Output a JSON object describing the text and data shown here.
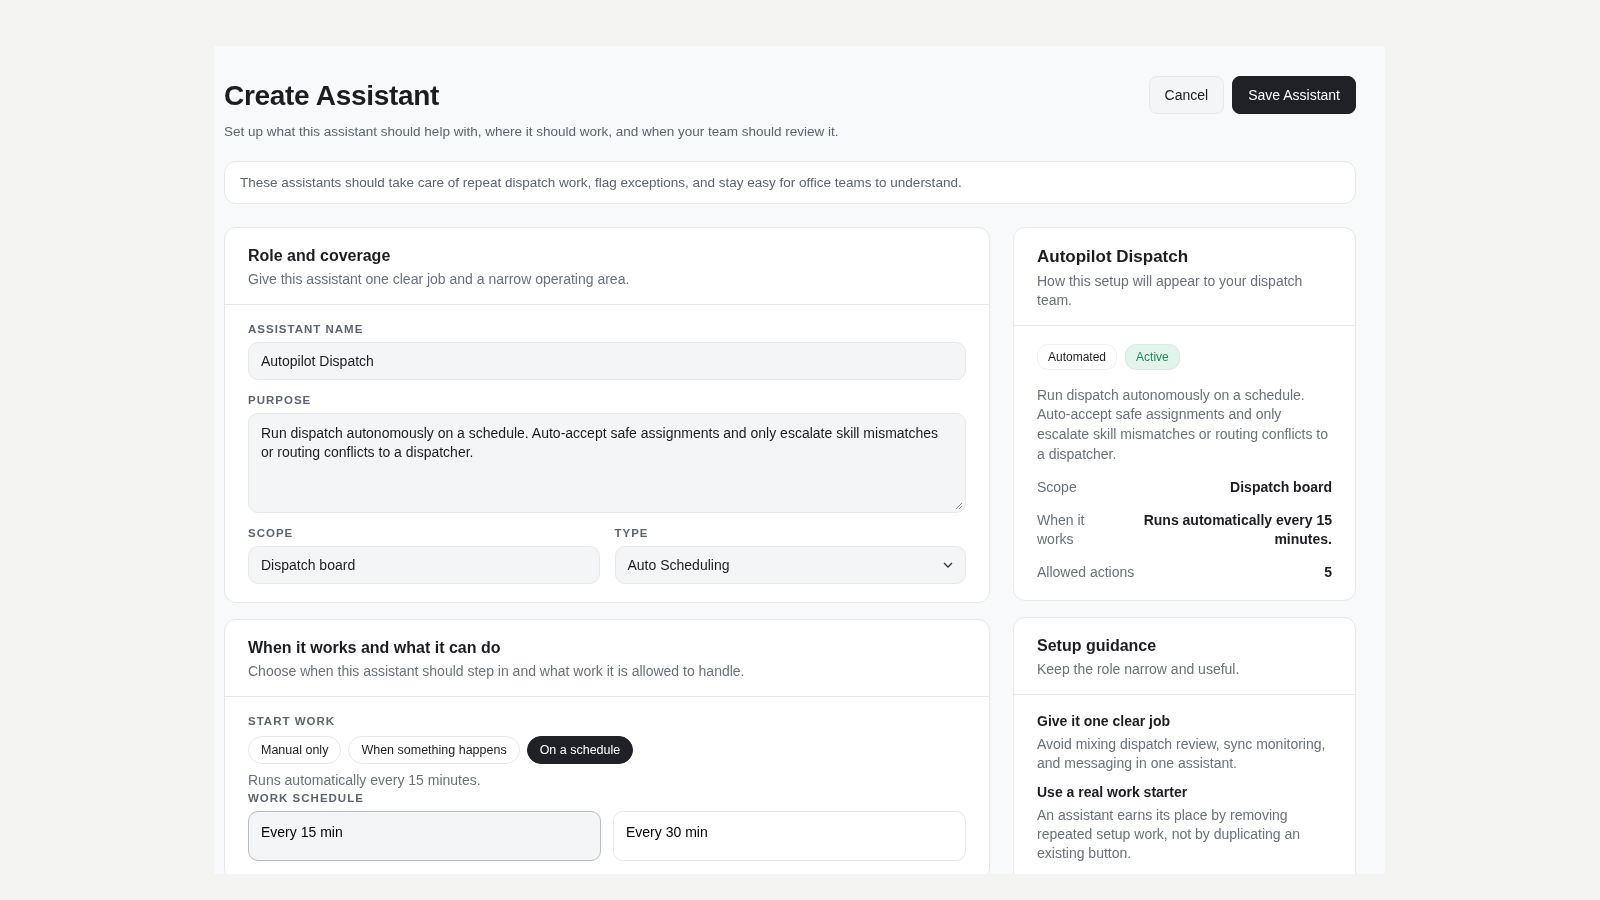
{
  "page": {
    "title": "Create Assistant",
    "subtitle": "Set up what this assistant should help with, where it should work, and when your team should review it."
  },
  "actions": [
    {
      "label": "Cancel",
      "kind": "secondary"
    },
    {
      "label": "Save Assistant",
      "kind": "primary"
    }
  ],
  "notice": "These assistants should take care of repeat dispatch work, flag exceptions, and stay easy for office teams to understand.",
  "role_section": {
    "title": "Role and coverage",
    "subtitle": "Give this assistant one clear job and a narrow operating area.",
    "fields": [
      {
        "kind": "input",
        "label": "ASSISTANT NAME",
        "value": "Autopilot Dispatch"
      },
      {
        "kind": "textarea",
        "label": "PURPOSE",
        "value": "Run dispatch autonomously on a schedule. Auto-accept safe assignments and only escalate skill mismatches or routing conflicts to a dispatcher."
      },
      {
        "kind": "input",
        "label": "SCOPE",
        "value": "Dispatch board"
      },
      {
        "kind": "select",
        "label": "TYPE",
        "value": "Auto Scheduling"
      }
    ]
  },
  "work_section": {
    "title": "When it works and what it can do",
    "subtitle": "Choose when this assistant should step in and what work it is allowed to handle.",
    "start_label": "START WORK",
    "start_options": [
      {
        "label": "Manual only",
        "selected": false
      },
      {
        "label": "When something happens",
        "selected": false
      },
      {
        "label": "On a schedule",
        "selected": true
      }
    ],
    "start_hint": "Runs automatically every 15 minutes.",
    "schedule_label": "WORK SCHEDULE",
    "schedule_options": [
      {
        "label": "Every 15 min",
        "selected": true
      },
      {
        "label": "Every 30 min",
        "selected": false
      }
    ]
  },
  "summary": {
    "title": "Autopilot Dispatch",
    "subtitle": "How this setup will appear to your dispatch team.",
    "tags": [
      {
        "label": "Automated",
        "kind": "neutral"
      },
      {
        "label": "Active",
        "kind": "success"
      }
    ],
    "description": "Run dispatch autonomously on a schedule. Auto-accept safe assignments and only escalate skill mismatches or routing conflicts to a dispatcher.",
    "details": [
      {
        "label": "Scope",
        "value": "Dispatch board"
      },
      {
        "label": "When it works",
        "value": "Runs automatically every 15 minutes."
      },
      {
        "label": "Allowed actions",
        "value": "5"
      }
    ]
  },
  "guidance": {
    "title": "Setup guidance",
    "subtitle": "Keep the role narrow and useful.",
    "tips": [
      {
        "title": "Give it one clear job",
        "body": "Avoid mixing dispatch review, sync monitoring, and messaging in one assistant."
      },
      {
        "title": "Use a real work starter",
        "body": "An assistant earns its place by removing repeated setup work, not by duplicating an existing button."
      }
    ]
  }
}
